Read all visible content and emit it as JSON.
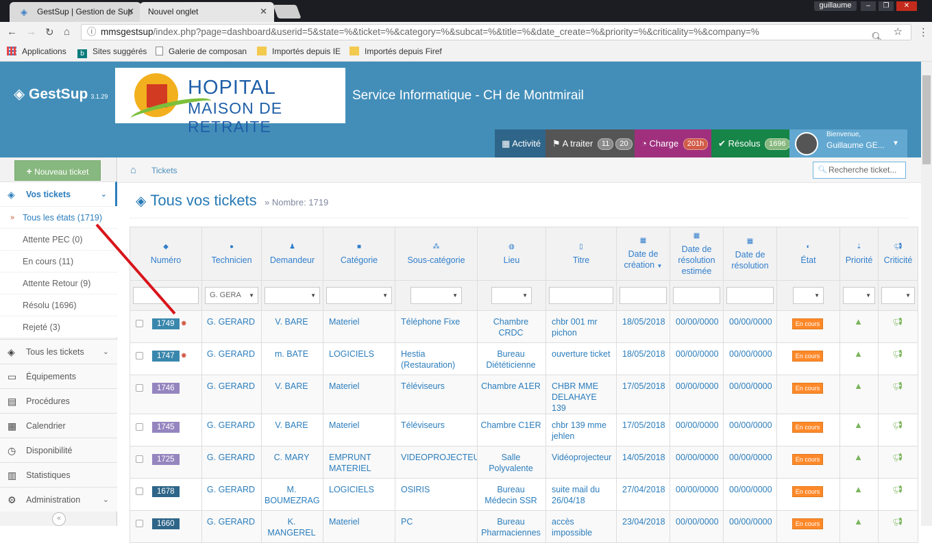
{
  "browser": {
    "tabs": [
      {
        "title": "GestSup | Gestion de Sup",
        "close": "✕"
      },
      {
        "title": "Nouvel onglet",
        "close": "✕"
      }
    ],
    "window_user": "guillaume",
    "url_host": "mmsgestsup",
    "url_path": "/index.php?page=dashboard&userid=5&state=%&ticket=%&category=%&subcat=%&title=%&date_create=%&priority=%&criticality=%&company=%",
    "bookmarks": [
      "Applications",
      "Sites suggérés",
      "Galerie de composan",
      "Importés depuis IE",
      "Importés depuis Firef"
    ]
  },
  "header": {
    "brand": "GestSup",
    "version": "3.1.29",
    "logo_line1": "HOPITAL",
    "logo_line2": "MAISON DE RETRAITE",
    "service": "Service Informatique - CH de Montmirail",
    "buttons": [
      {
        "label": "Activité",
        "icon": "calendar-icon",
        "color": "#2e6589"
      },
      {
        "label": "A traiter",
        "badges": [
          "11",
          "20"
        ],
        "icon": "flag-icon",
        "color": "#555555"
      },
      {
        "label": "Charge",
        "badges": [
          "201h"
        ],
        "badge_color": "#d15b47",
        "icon": "dashboard-icon",
        "color": "#a0307e"
      },
      {
        "label": "Résolus",
        "badges": [
          "1696"
        ],
        "badge_color": "#87b87f",
        "icon": "check-circle-icon",
        "color": "#178547"
      }
    ],
    "user_welcome": "Bienvenue,",
    "user_name": "Guillaume GE..."
  },
  "sidebar": {
    "new_ticket": "Nouveau ticket",
    "vos_tickets": "Vos tickets",
    "sub_items": [
      "Tous les états (1719)",
      "Attente PEC (0)",
      "En cours (11)",
      "Attente Retour (9)",
      "Résolu (1696)",
      "Rejeté (3)"
    ],
    "groups": [
      "Tous les tickets",
      "Équipements",
      "Procédures",
      "Calendrier",
      "Disponibilité",
      "Statistiques",
      "Administration"
    ]
  },
  "breadcrumb": "Tickets",
  "search_placeholder": "Recherche ticket...",
  "page_title": "Tous vos tickets",
  "count_label": "» Nombre: 1719",
  "columns": [
    "Numéro",
    "Technicien",
    "Demandeur",
    "Catégorie",
    "Sous-catégorie",
    "Lieu",
    "Titre",
    "Date de création",
    "Date de résolution estimée",
    "Date de résolution",
    "État",
    "Priorité",
    "Criticité"
  ],
  "filter_technician": "G. GERA",
  "rows": [
    {
      "num": "1749",
      "num_color": "#3a87ad",
      "new": true,
      "tech": "G. GERARD",
      "req": "V. BARE",
      "cat": "Materiel",
      "subcat": "Téléphone Fixe",
      "lieu": "Chambre CRDC",
      "titre": "chbr 001 mr pichon",
      "created": "18/05/2018",
      "est": "00/00/0000",
      "res": "00/00/0000",
      "etat": "En cours"
    },
    {
      "num": "1747",
      "num_color": "#3a87ad",
      "new": true,
      "tech": "G. GERARD",
      "req": "m. BATE",
      "cat": "LOGICIELS",
      "subcat": "Hestia (Restauration)",
      "lieu": "Bureau Diététicienne",
      "titre": "ouverture ticket",
      "created": "18/05/2018",
      "est": "00/00/0000",
      "res": "00/00/0000",
      "etat": "En cours"
    },
    {
      "num": "1746",
      "num_color": "#9585bf",
      "new": false,
      "tech": "G. GERARD",
      "req": "V. BARE",
      "cat": "Materiel",
      "subcat": "Téléviseurs",
      "lieu": "Chambre A1ER",
      "titre": "CHBR MME DELAHAYE 139",
      "created": "17/05/2018",
      "est": "00/00/0000",
      "res": "00/00/0000",
      "etat": "En cours"
    },
    {
      "num": "1745",
      "num_color": "#9585bf",
      "new": false,
      "tech": "G. GERARD",
      "req": "V. BARE",
      "cat": "Materiel",
      "subcat": "Téléviseurs",
      "lieu": "Chambre C1ER",
      "titre": "chbr 139 mme jehlen",
      "created": "17/05/2018",
      "est": "00/00/0000",
      "res": "00/00/0000",
      "etat": "En cours"
    },
    {
      "num": "1725",
      "num_color": "#9585bf",
      "new": false,
      "tech": "G. GERARD",
      "req": "C. MARY",
      "cat": "EMPRUNT MATERIEL",
      "subcat": "VIDEOPROJECTEUR",
      "lieu": "Salle Polyvalente",
      "titre": "Vidéoprojecteur",
      "created": "14/05/2018",
      "est": "00/00/0000",
      "res": "00/00/0000",
      "etat": "En cours"
    },
    {
      "num": "1678",
      "num_color": "#2e6589",
      "new": false,
      "tech": "G. GERARD",
      "req": "M. BOUMEZRAG",
      "cat": "LOGICIELS",
      "subcat": "OSIRIS",
      "lieu": "Bureau Médecin SSR",
      "titre": "suite mail du 26/04/18",
      "created": "27/04/2018",
      "est": "00/00/0000",
      "res": "00/00/0000",
      "etat": "En cours"
    },
    {
      "num": "1660",
      "num_color": "#2e6589",
      "new": false,
      "tech": "G. GERARD",
      "req": "K. MANGEREL",
      "cat": "Materiel",
      "subcat": "PC",
      "lieu": "Bureau Pharmaciennes",
      "titre": "accès impossible",
      "created": "23/04/2018",
      "est": "00/00/0000",
      "res": "00/00/0000",
      "etat": "En cours"
    }
  ]
}
